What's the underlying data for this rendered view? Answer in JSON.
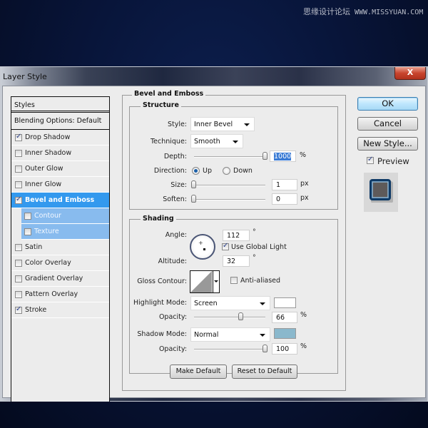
{
  "watermark": {
    "chinese": "思缘设计论坛",
    "site": "WWW.MISSYUAN.COM"
  },
  "window": {
    "title": "Layer Style",
    "close_label": "X"
  },
  "styles_panel": {
    "header": "Styles",
    "blending_options": "Blending Options: Default",
    "items": [
      {
        "label": "Drop Shadow",
        "checked": true
      },
      {
        "label": "Inner Shadow",
        "checked": false
      },
      {
        "label": "Outer Glow",
        "checked": false
      },
      {
        "label": "Inner Glow",
        "checked": false
      },
      {
        "label": "Bevel and Emboss",
        "checked": true,
        "active": true
      },
      {
        "label": "Contour",
        "checked": false,
        "sub": true
      },
      {
        "label": "Texture",
        "checked": false,
        "sub": true
      },
      {
        "label": "Satin",
        "checked": false
      },
      {
        "label": "Color Overlay",
        "checked": false
      },
      {
        "label": "Gradient Overlay",
        "checked": false
      },
      {
        "label": "Pattern Overlay",
        "checked": false
      },
      {
        "label": "Stroke",
        "checked": true
      }
    ]
  },
  "bevel": {
    "title": "Bevel and Emboss",
    "structure": {
      "legend": "Structure",
      "style_label": "Style:",
      "style_value": "Inner Bevel",
      "technique_label": "Technique:",
      "technique_value": "Smooth",
      "depth_label": "Depth:",
      "depth_value": "1000",
      "depth_unit": "%",
      "depth_slider_fraction": 1.0,
      "direction_label": "Direction:",
      "direction_up": "Up",
      "direction_down": "Down",
      "direction_selected": "Up",
      "size_label": "Size:",
      "size_value": "1",
      "size_unit": "px",
      "size_slider_fraction": 0.0,
      "soften_label": "Soften:",
      "soften_value": "0",
      "soften_unit": "px",
      "soften_slider_fraction": 0.0
    },
    "shading": {
      "legend": "Shading",
      "angle_label": "Angle:",
      "angle_value": "112",
      "degree_symbol": "°",
      "use_global_light": "Use Global Light",
      "use_global_light_checked": true,
      "altitude_label": "Altitude:",
      "altitude_value": "32",
      "gloss_contour_label": "Gloss Contour:",
      "anti_aliased": "Anti-aliased",
      "anti_aliased_checked": false,
      "highlight_mode_label": "Highlight Mode:",
      "highlight_mode_value": "Screen",
      "highlight_color": "#ffffff",
      "highlight_opacity_label": "Opacity:",
      "highlight_opacity_value": "66",
      "highlight_opacity_unit": "%",
      "shadow_mode_label": "Shadow Mode:",
      "shadow_mode_value": "Normal",
      "shadow_color": "#8ab8cc",
      "shadow_opacity_label": "Opacity:",
      "shadow_opacity_value": "100",
      "shadow_opacity_unit": "%"
    },
    "make_default": "Make Default",
    "reset_to_default": "Reset to Default"
  },
  "right_panel": {
    "ok": "OK",
    "cancel": "Cancel",
    "new_style": "New Style...",
    "preview": "Preview",
    "preview_checked": true
  }
}
